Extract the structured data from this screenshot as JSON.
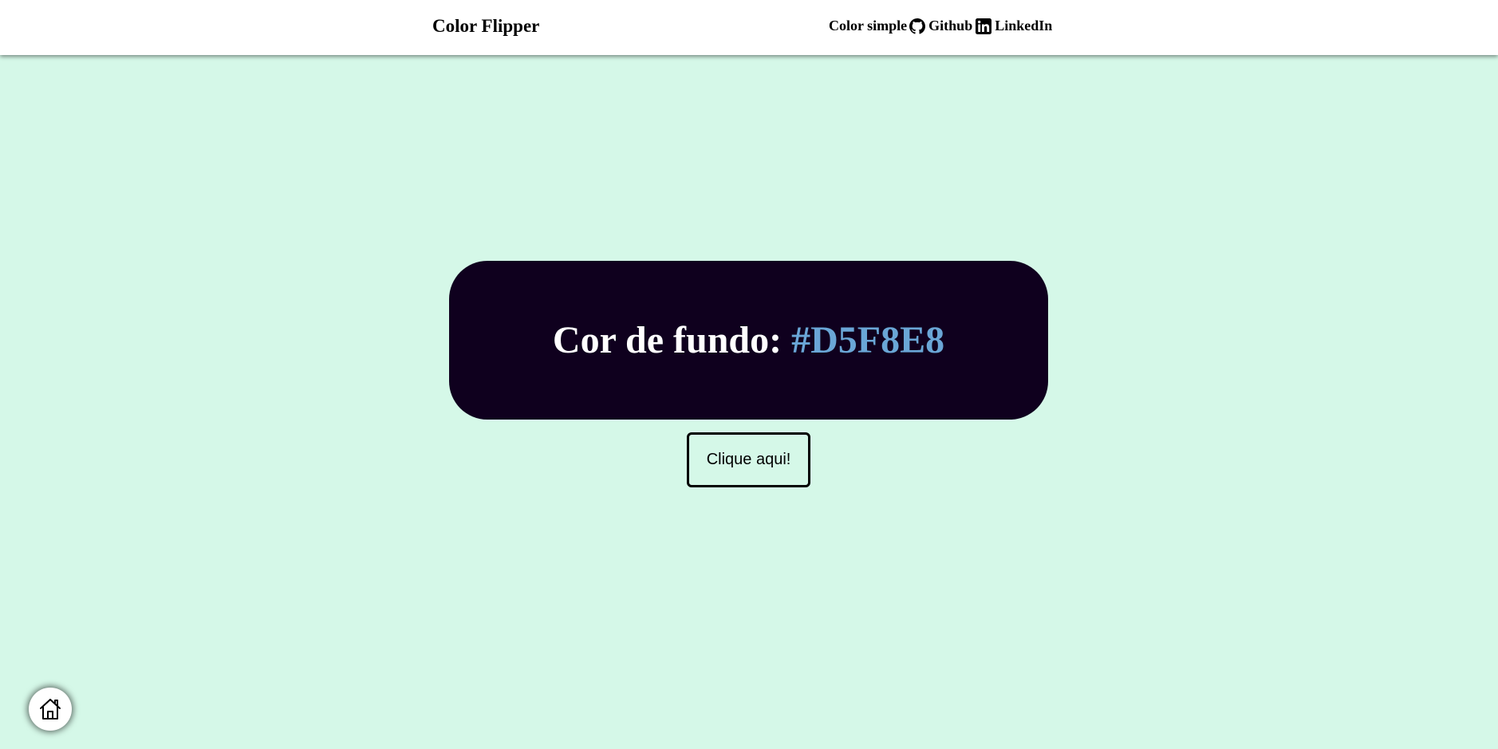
{
  "navbar": {
    "brand": "Color Flipper",
    "links": [
      {
        "label": "Color simple",
        "icon": null
      },
      {
        "label": "Github",
        "icon": "github-icon"
      },
      {
        "label": "LinkedIn",
        "icon": "linkedin-icon"
      }
    ]
  },
  "main": {
    "label": "Cor de fundo: ",
    "color_value": "#D5F8E8",
    "button_label": "Clique aqui!"
  },
  "home_button": {
    "icon": "home-icon"
  },
  "colors": {
    "page_background": "#D5F8E8",
    "navbar_background": "#ffffff",
    "box_background": "#0f001e",
    "title_text": "#ffffff",
    "color_value_text": "#6aa6d6"
  }
}
